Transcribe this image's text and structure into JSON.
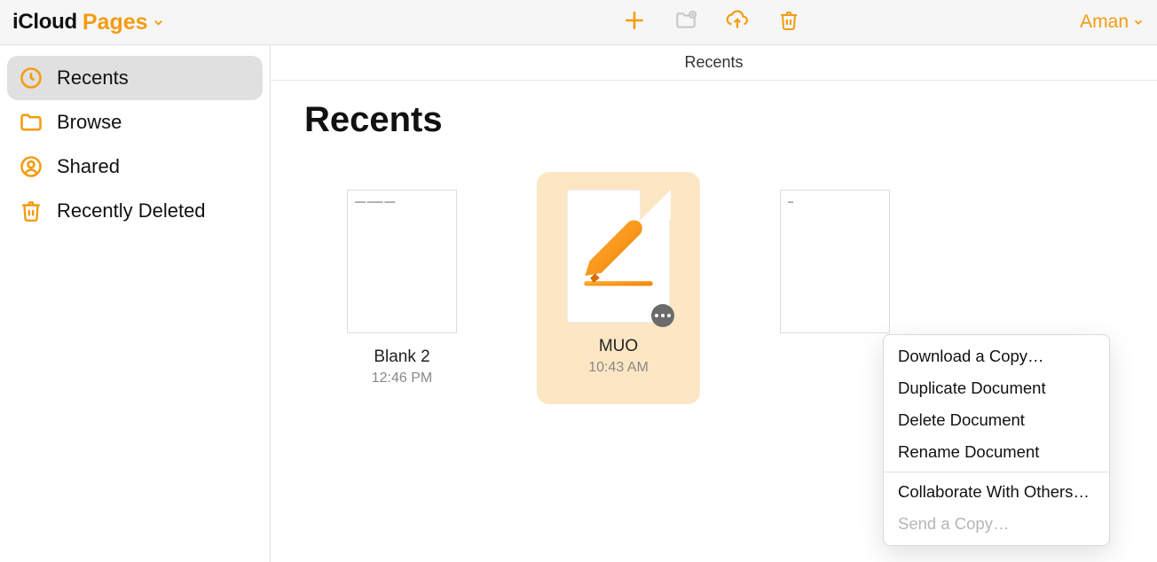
{
  "header": {
    "icloud_label": "iCloud",
    "app_label": "Pages",
    "user_label": "Aman"
  },
  "sidebar": {
    "items": [
      {
        "label": "Recents"
      },
      {
        "label": "Browse"
      },
      {
        "label": "Shared"
      },
      {
        "label": "Recently Deleted"
      }
    ]
  },
  "content": {
    "subheader": "Recents",
    "title": "Recents",
    "documents": [
      {
        "name": "Blank 2",
        "time": "12:46 PM"
      },
      {
        "name": "MUO",
        "time": "10:43 AM"
      },
      {
        "name": "",
        "time": ""
      }
    ]
  },
  "context_menu": {
    "items": [
      {
        "label": "Download a Copy…"
      },
      {
        "label": "Duplicate Document"
      },
      {
        "label": "Delete Document"
      },
      {
        "label": "Rename Document"
      }
    ],
    "items2": [
      {
        "label": "Collaborate With Others…"
      },
      {
        "label": "Send a Copy…"
      }
    ]
  }
}
